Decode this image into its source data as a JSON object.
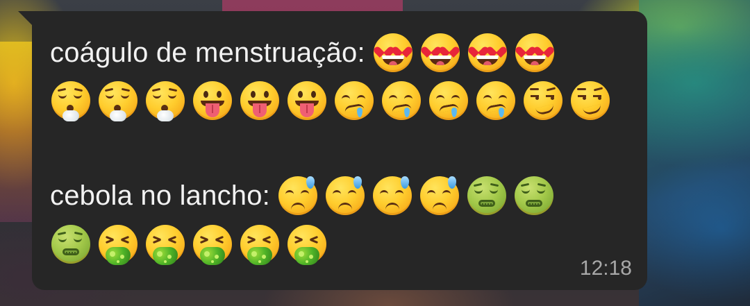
{
  "message": {
    "line1_label": "coágulo de menstruação:",
    "line2_label": "cebola no lancho:",
    "time": "12:18",
    "emoji_names": {
      "heart_eyes": "smiling face with heart-eyes",
      "exhale": "face exhaling",
      "tongue": "face with tongue",
      "drool": "drooling face",
      "smirk": "smirking face",
      "sweat": "downcast face with sweat",
      "nauseated": "nauseated face",
      "vomit": "face vomiting"
    }
  },
  "colors": {
    "bubble": "#262626",
    "text": "#f2f2f2",
    "timestamp": "#a8a8a8"
  }
}
